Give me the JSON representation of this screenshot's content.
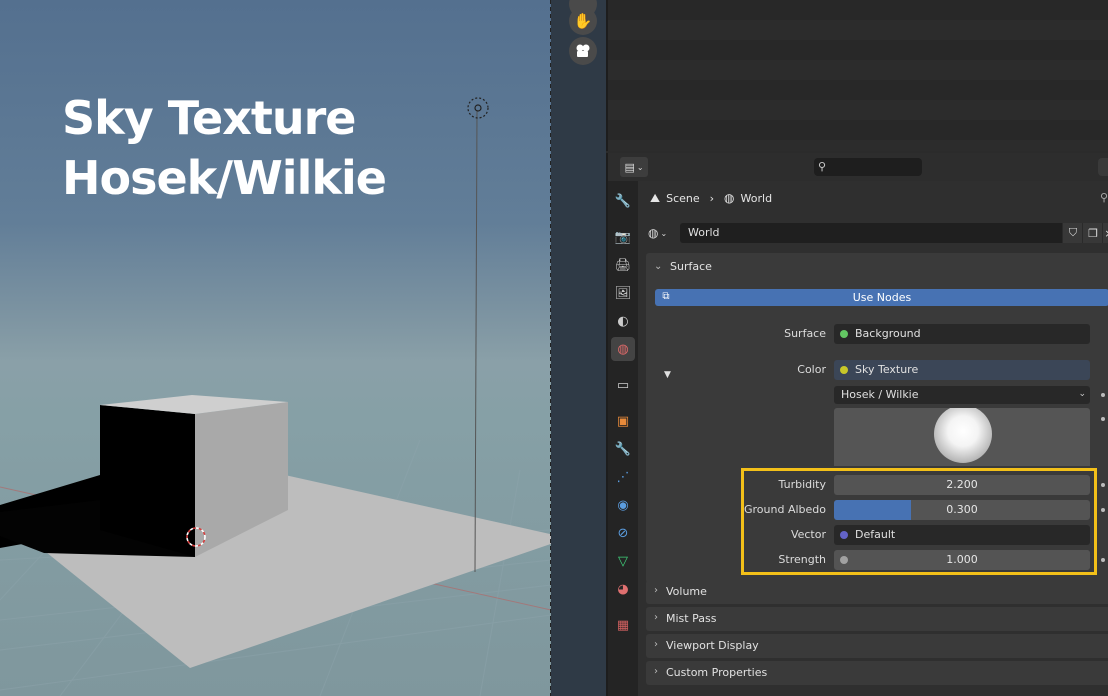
{
  "overlay": {
    "line1": "Sky Texture",
    "line2": "Hosek/Wilkie"
  },
  "header": {
    "search_placeholder": ""
  },
  "breadcrumb": {
    "scene": "Scene",
    "world": "World"
  },
  "datablock": {
    "name": "World"
  },
  "panels": {
    "surface": {
      "title": "Surface",
      "use_nodes_label": "Use Nodes",
      "surface_label": "Surface",
      "surface_value": "Background",
      "color_label": "Color",
      "color_value": "Sky Texture",
      "sky_type": "Hosek / Wilkie",
      "turbidity_label": "Turbidity",
      "turbidity_value": "2.200",
      "albedo_label": "Ground Albedo",
      "albedo_value": "0.300",
      "albedo_fraction": 0.3,
      "vector_label": "Vector",
      "vector_value": "Default",
      "strength_label": "Strength",
      "strength_value": "1.000"
    },
    "collapsed": [
      "Volume",
      "Mist Pass",
      "Viewport Display",
      "Custom Properties"
    ]
  },
  "colors": {
    "accent_blue": "#4772b3",
    "highlight_yellow": "#f3c019",
    "socket_green": "#63c763",
    "socket_yellow": "#c7c729",
    "socket_purple": "#6363c7",
    "socket_gray": "#a1a1a1"
  },
  "icons": {
    "tabs": [
      "tool-icon",
      "render-icon",
      "output-icon",
      "view-layer-icon",
      "scene-icon",
      "world-icon",
      "collection-icon",
      "object-icon",
      "modifier-icon",
      "particles-icon",
      "physics-icon",
      "constraints-icon",
      "object-data-icon",
      "material-icon",
      "texture-icon"
    ]
  }
}
